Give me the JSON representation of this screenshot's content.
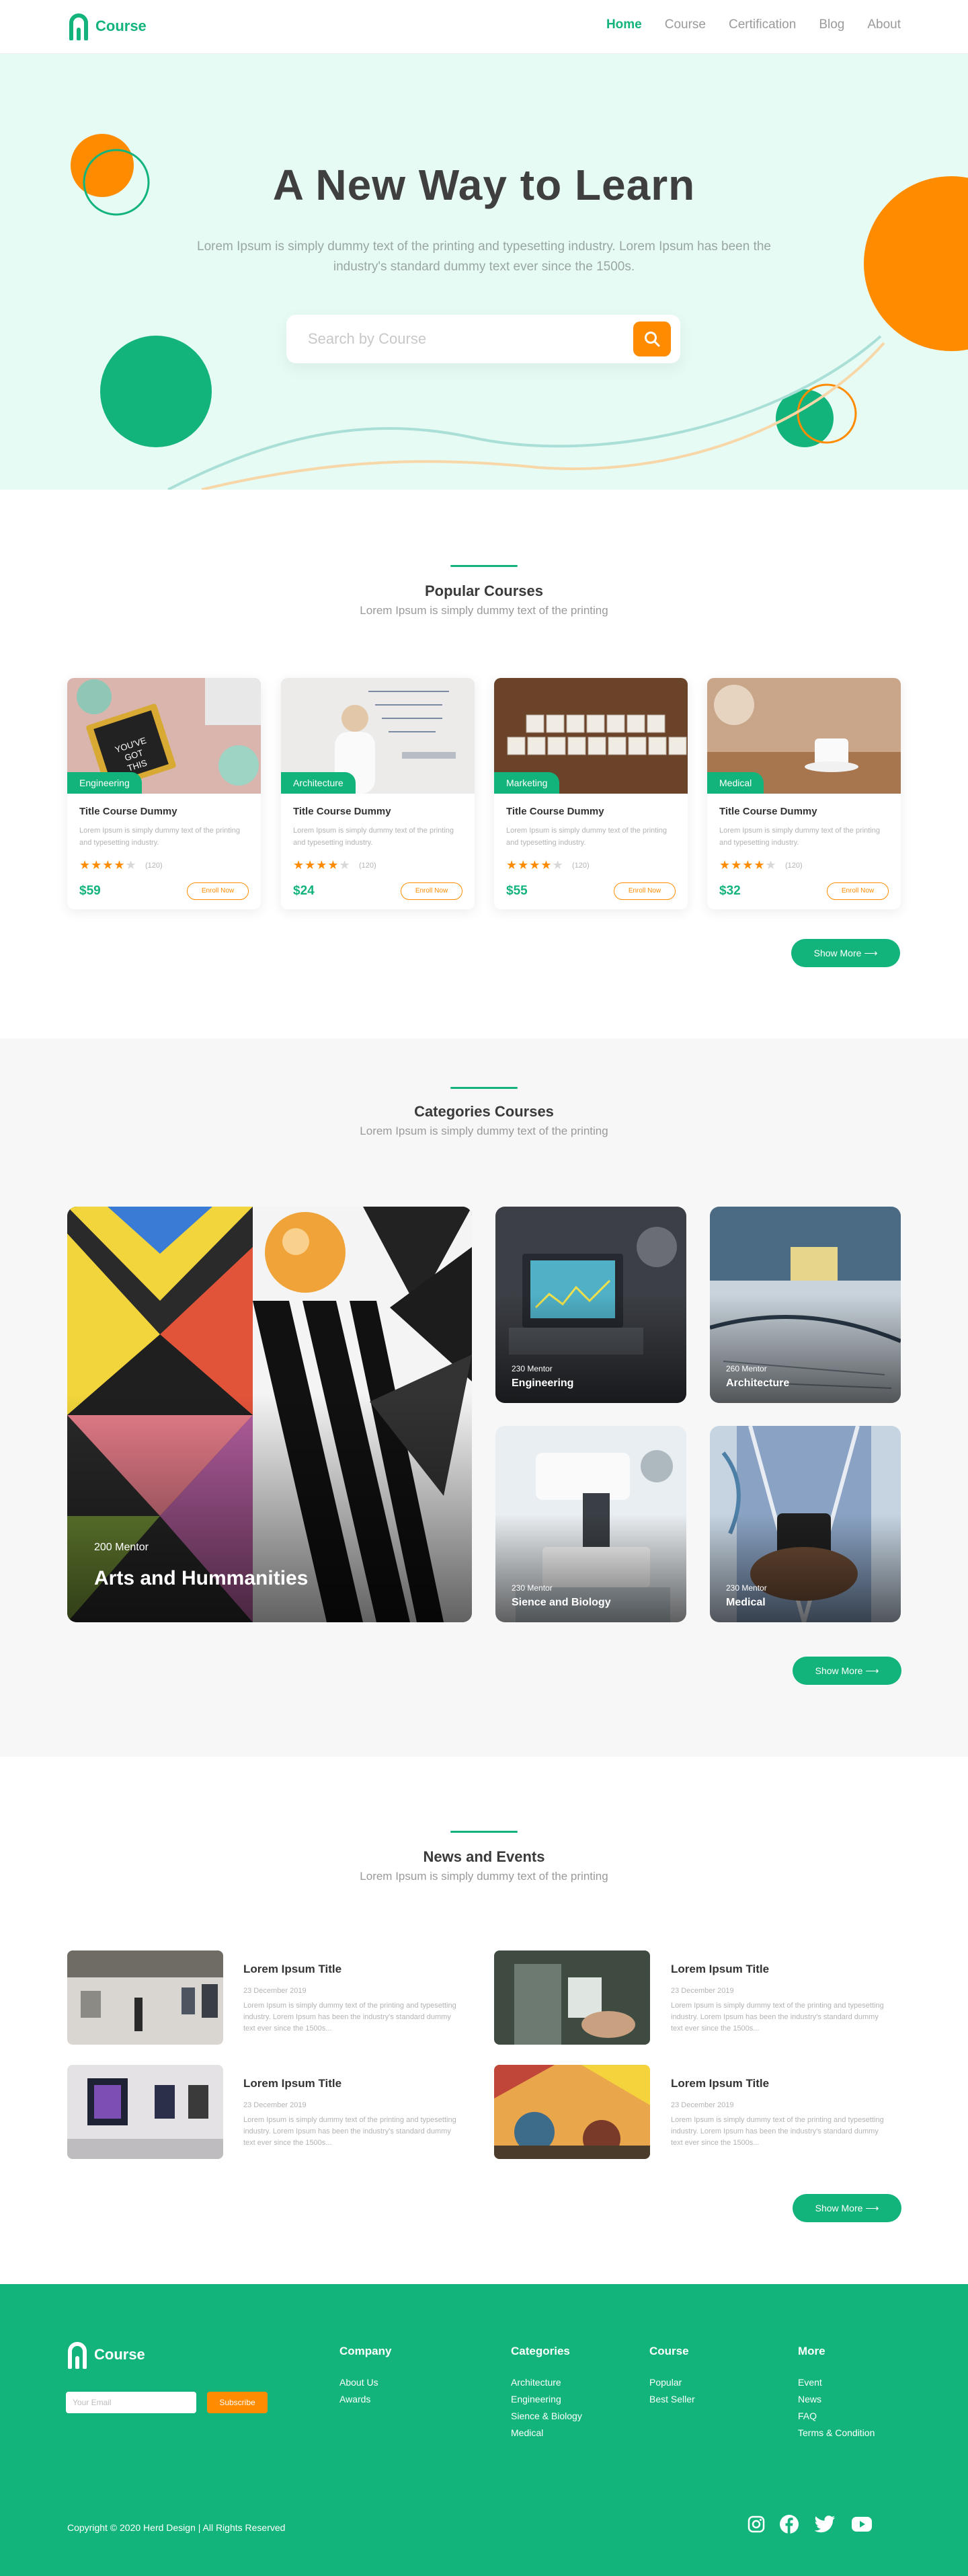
{
  "header": {
    "logo_text": "Course",
    "nav": [
      "Home",
      "Course",
      "Certification",
      "Blog",
      "About"
    ]
  },
  "hero": {
    "title": "A New Way to Learn",
    "subtitle": "Lorem Ipsum is simply dummy text of the printing and typesetting industry. Lorem Ipsum has been the industry's standard dummy text ever since the 1500s.",
    "search_placeholder": "Search by Course"
  },
  "colors": {
    "accent": "#12b47b",
    "orange": "#ff8c00",
    "hero_bg": "#e7fbf5"
  },
  "popular": {
    "title": "Popular Courses",
    "subtitle": "Lorem Ipsum is simply dummy text of the printing",
    "cards": [
      {
        "tag": "Engineering",
        "title": "Title Course Dummy",
        "desc": "Lorem Ipsum is simply dummy text of the printing and typesetting industry.",
        "rating": 4,
        "count": "(120)",
        "price": "$59",
        "enroll": "Enroll Now"
      },
      {
        "tag": "Architecture",
        "title": "Title Course Dummy",
        "desc": "Lorem Ipsum is simply dummy text of the printing and typesetting industry.",
        "rating": 4,
        "count": "(120)",
        "price": "$24",
        "enroll": "Enroll Now"
      },
      {
        "tag": "Marketing",
        "title": "Title Course Dummy",
        "desc": "Lorem Ipsum is simply dummy text of the printing and typesetting industry.",
        "rating": 4,
        "count": "(120)",
        "price": "$55",
        "enroll": "Enroll Now"
      },
      {
        "tag": "Medical",
        "title": "Title Course Dummy",
        "desc": "Lorem Ipsum is simply dummy text of the printing and typesetting industry.",
        "rating": 4,
        "count": "(120)",
        "price": "$32",
        "enroll": "Enroll Now"
      }
    ],
    "more": "Show More"
  },
  "categories": {
    "title": "Categories Courses",
    "subtitle": "Lorem Ipsum is simply dummy text of the printing",
    "items": [
      {
        "mentor": "200 Mentor",
        "name": "Arts and Hummanities"
      },
      {
        "mentor": "230 Mentor",
        "name": "Engineering"
      },
      {
        "mentor": "260 Mentor",
        "name": "Architecture"
      },
      {
        "mentor": "230 Mentor",
        "name": "Sience and Biology"
      },
      {
        "mentor": "230 Mentor",
        "name": "Medical"
      }
    ],
    "more": "Show More"
  },
  "news": {
    "title": "News and Events",
    "subtitle": "Lorem Ipsum is simply dummy text of the printing",
    "items": [
      {
        "title": "Lorem Ipsum Title",
        "date": "23 December 2019",
        "desc": "Lorem Ipsum is simply dummy text of the printing and typesetting industry. Lorem Ipsum has been the industry's standard dummy text ever since the 1500s..."
      },
      {
        "title": "Lorem Ipsum Title",
        "date": "23 December 2019",
        "desc": "Lorem Ipsum is simply dummy text of the printing and typesetting industry. Lorem Ipsum has been the industry's standard dummy text ever since the 1500s..."
      },
      {
        "title": "Lorem Ipsum Title",
        "date": "23 December 2019",
        "desc": "Lorem Ipsum is simply dummy text of the printing and typesetting industry. Lorem Ipsum has been the industry's standard dummy text ever since the 1500s..."
      },
      {
        "title": "Lorem Ipsum Title",
        "date": "23 December 2019",
        "desc": "Lorem Ipsum is simply dummy text of the printing and typesetting industry. Lorem Ipsum has been the industry's standard dummy text ever since the 1500s..."
      }
    ],
    "more": "Show More"
  },
  "footer": {
    "logo_text": "Course",
    "email_placeholder": "Your Email",
    "subscribe": "Subscribe",
    "columns": [
      {
        "title": "Company",
        "links": [
          "About Us",
          "Awards"
        ]
      },
      {
        "title": "Categories",
        "links": [
          "Architecture",
          "Engineering",
          "Sience & Biology",
          "Medical"
        ]
      },
      {
        "title": "Course",
        "links": [
          "Popular",
          "Best Seller"
        ]
      },
      {
        "title": "More",
        "links": [
          "Event",
          "News",
          "FAQ",
          "Terms & Condition"
        ]
      }
    ],
    "copyright": "Copyright © 2020 Herd Design  |   All Rights Reserved",
    "social": [
      "instagram-icon",
      "facebook-icon",
      "twitter-icon",
      "youtube-icon"
    ]
  }
}
